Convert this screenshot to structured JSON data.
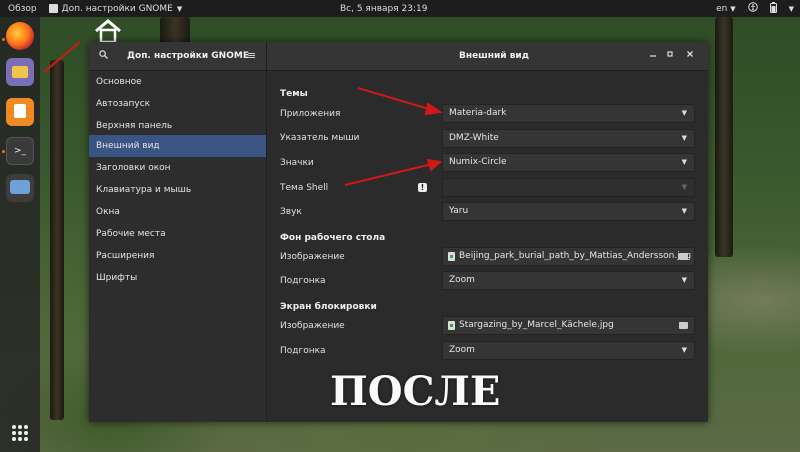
{
  "topbar": {
    "overview": "Обзор",
    "app_name": "Доп. настройки GNOME",
    "clock": "Вс, 5 января  23:19",
    "keyboard_layout": "en"
  },
  "window": {
    "sidebar_title": "Доп. настройки GNOME",
    "content_title": "Внешний вид",
    "sidebar_items": [
      {
        "label": "Основное"
      },
      {
        "label": "Автозапуск"
      },
      {
        "label": "Верхняя панель"
      },
      {
        "label": "Внешний вид",
        "active": true
      },
      {
        "label": "Заголовки окон"
      },
      {
        "label": "Клавиатура и мышь"
      },
      {
        "label": "Окна"
      },
      {
        "label": "Рабочие места"
      },
      {
        "label": "Расширения"
      },
      {
        "label": "Шрифты"
      }
    ],
    "themes": {
      "section": "Темы",
      "applications_label": "Приложения",
      "applications_value": "Materia-dark",
      "cursor_label": "Указатель мыши",
      "cursor_value": "DMZ-White",
      "icons_label": "Значки",
      "icons_value": "Numix-Circle",
      "shell_label": "Тема Shell",
      "shell_value": "",
      "sound_label": "Звук",
      "sound_value": "Yaru"
    },
    "background": {
      "section": "Фон рабочего стола",
      "image_label": "Изображение",
      "image_value": "Beijing_park_burial_path_by_Mattias_Andersson.jpg",
      "fit_label": "Подгонка",
      "fit_value": "Zoom"
    },
    "lockscreen": {
      "section": "Экран блокировки",
      "image_label": "Изображение",
      "image_value": "Stargazing_by_Marcel_Kächele.jpg",
      "fit_label": "Подгонка",
      "fit_value": "Zoom"
    }
  },
  "overlay_caption": "ПОСЛЕ",
  "colors": {
    "accent": "#3a5483",
    "arrow": "#d01818"
  }
}
